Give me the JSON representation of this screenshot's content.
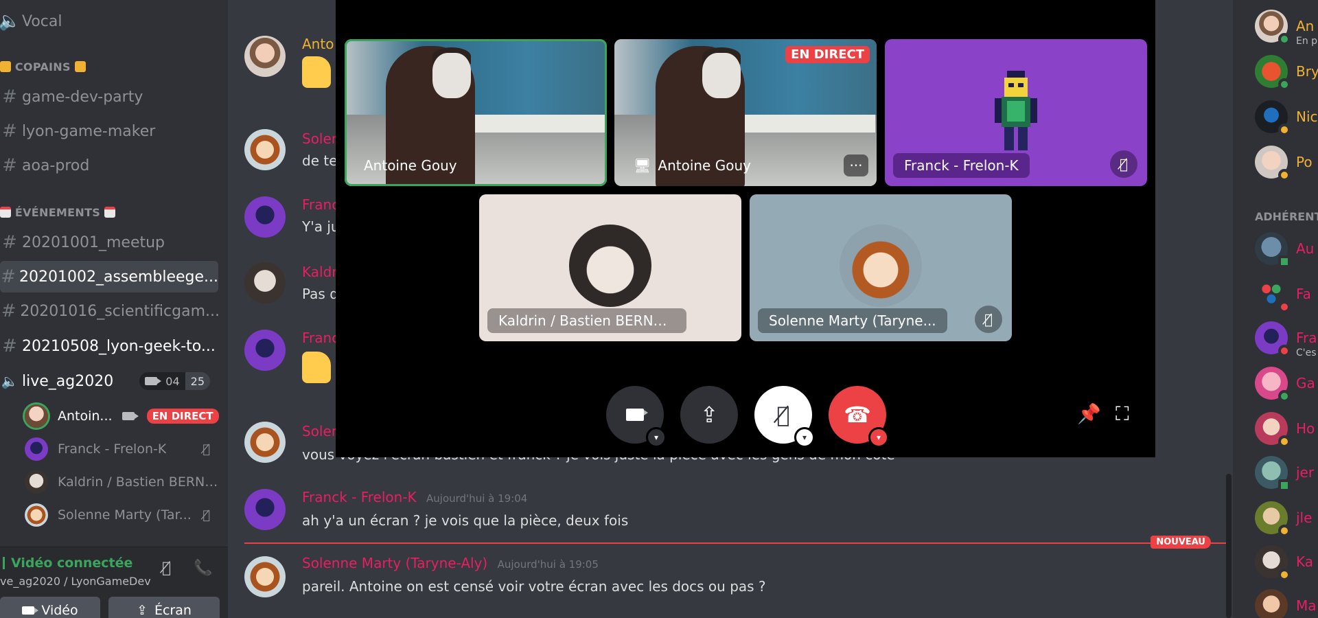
{
  "sidebar": {
    "top_channel": "Vocal",
    "categories": {
      "copains": "COPAINS",
      "evenements": "ÉVÉNEMENTS"
    },
    "copains_channels": [
      "game-dev-party",
      "lyon-game-maker",
      "aoa-prod"
    ],
    "event_channels": [
      "20201001_meetup",
      "20201002_assembleege...",
      "20201016_scientificgam...",
      "20210508_lyon-geek-to..."
    ],
    "voice_channel": {
      "name": "live_ag2020",
      "video_count": "04",
      "user_limit": "25"
    },
    "voice_users": [
      {
        "name": "Antoin...",
        "live": "EN DIRECT"
      },
      {
        "name": "Franck - Frelon-K"
      },
      {
        "name": "Kaldrin / Bastien BERNA..."
      },
      {
        "name": "Solenne Marty (Tar..."
      }
    ],
    "panel": {
      "status": "Vidéo connectée",
      "location": "ve_ag2020 / LyonGameDev",
      "video_button": "Vidéo",
      "screen_button": "Écran"
    }
  },
  "chat": {
    "messages": [
      {
        "author": "Anto",
        "color": "#f0b232"
      },
      {
        "author": "Solen",
        "text": "de te",
        "color": "#e91e63"
      },
      {
        "author": "Franc",
        "text": "Y'a ju",
        "color": "#e91e63"
      },
      {
        "author": "Kaldr",
        "text": "Pas d",
        "color": "#e91e63"
      },
      {
        "author": "Franc",
        "color": "#e91e63"
      },
      {
        "author": "Solen",
        "text": "vous voyez l'écran bastien et franck ? je vois juste la pièce avec les gens de mon côté",
        "color": "#e91e63"
      },
      {
        "author": "Franck - Frelon-K",
        "time": "Aujourd'hui à 19:04",
        "text": "ah y'a un écran ? je vois que la pièce, deux fois",
        "color": "#e91e63"
      },
      {
        "author": "Solenne Marty (Taryne-Aly)",
        "time": "Aujourd'hui à 19:05",
        "text": "pareil. Antoine on est censé voir votre écran avec les docs ou pas ?",
        "color": "#e91e63"
      }
    ],
    "new_badge": "NOUVEAU"
  },
  "video": {
    "tiles": [
      {
        "name": "Antoine Gouy"
      },
      {
        "name": "Antoine Gouy",
        "live": "EN DIRECT",
        "more": "···"
      },
      {
        "name": "Franck - Frelon-K"
      },
      {
        "name": "Kaldrin / Bastien BERNAND"
      },
      {
        "name": "Solenne Marty (Taryne..."
      }
    ]
  },
  "members": {
    "list_top": [
      {
        "name": "An",
        "sub": "En p",
        "color": "#f0b232"
      },
      {
        "name": "Bry",
        "color": "#f0b232"
      },
      {
        "name": "Nic",
        "color": "#f0b232"
      },
      {
        "name": "Po",
        "color": "#f0b232"
      }
    ],
    "category": "ADHÉRENTS",
    "list_bottom": [
      {
        "name": "Au",
        "color": "#e91e63"
      },
      {
        "name": "Fa",
        "color": "#e91e63"
      },
      {
        "name": "Fra",
        "sub": "C'es",
        "color": "#e91e63"
      },
      {
        "name": "Ga",
        "color": "#e91e63"
      },
      {
        "name": "Ho",
        "color": "#e91e63"
      },
      {
        "name": "jer",
        "color": "#e91e63"
      },
      {
        "name": "jle",
        "color": "#e91e63"
      },
      {
        "name": "Ka",
        "color": "#e91e63"
      },
      {
        "name": "Ma",
        "color": "#e91e63"
      }
    ]
  },
  "colors": {
    "accent_green": "#3ba55d",
    "live_red": "#ed4245",
    "mention_pink": "#e91e63",
    "yellow_role": "#f0b232",
    "purple_tile": "#8a42c8"
  }
}
